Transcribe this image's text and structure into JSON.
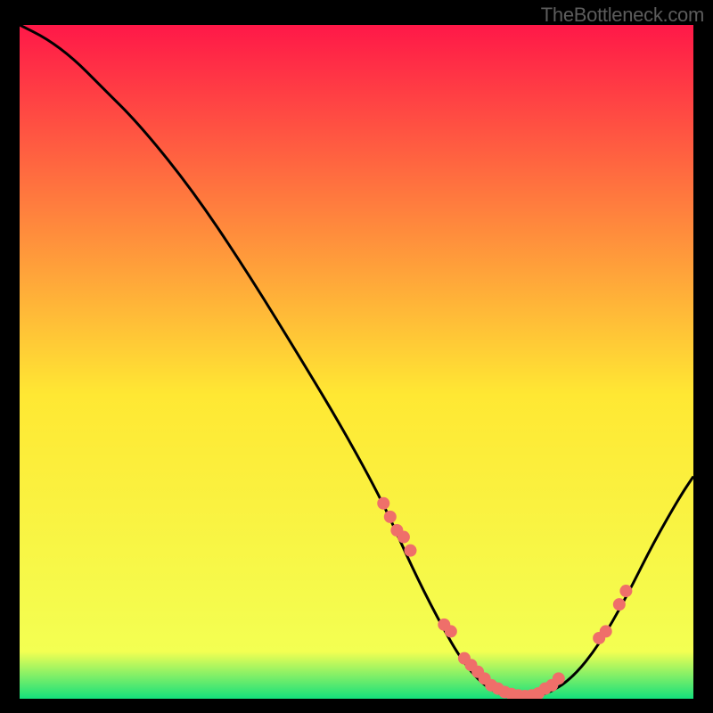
{
  "attribution": "TheBottleneck.com",
  "palette": {
    "gradient_top": "#ff1848",
    "gradient_mid": "#ffe833",
    "gradient_bottom": "#14e07c",
    "curve": "#000000",
    "marker": "#ef6f6a",
    "frame_bg": "#000000"
  },
  "chart_data": {
    "type": "line",
    "title": "",
    "xlabel": "",
    "ylabel": "",
    "xlim": [
      0,
      100
    ],
    "ylim": [
      0,
      100
    ],
    "curve": {
      "x": [
        0,
        4,
        8,
        12,
        18,
        26,
        34,
        42,
        48,
        54,
        58,
        62,
        66,
        70,
        74,
        78,
        82,
        86,
        90,
        94,
        98,
        100
      ],
      "y": [
        100,
        98,
        95,
        91,
        85,
        75,
        63,
        50,
        40,
        29,
        20,
        12,
        5,
        1,
        0,
        0.5,
        3,
        8,
        15,
        23,
        30,
        33
      ]
    },
    "markers": {
      "description": "scatter points on curve (salmon)",
      "x": [
        54,
        55,
        56,
        57,
        58,
        63,
        64,
        66,
        67,
        68,
        69,
        70,
        71,
        72,
        73,
        74,
        75,
        76,
        77,
        78,
        79,
        80,
        86,
        87,
        89,
        90
      ],
      "y": [
        29,
        27,
        25,
        24,
        22,
        11,
        10,
        6,
        5,
        4,
        3,
        2,
        1.5,
        1,
        0.7,
        0.5,
        0.4,
        0.5,
        0.8,
        1.5,
        2,
        3,
        9,
        10,
        14,
        16
      ]
    }
  }
}
